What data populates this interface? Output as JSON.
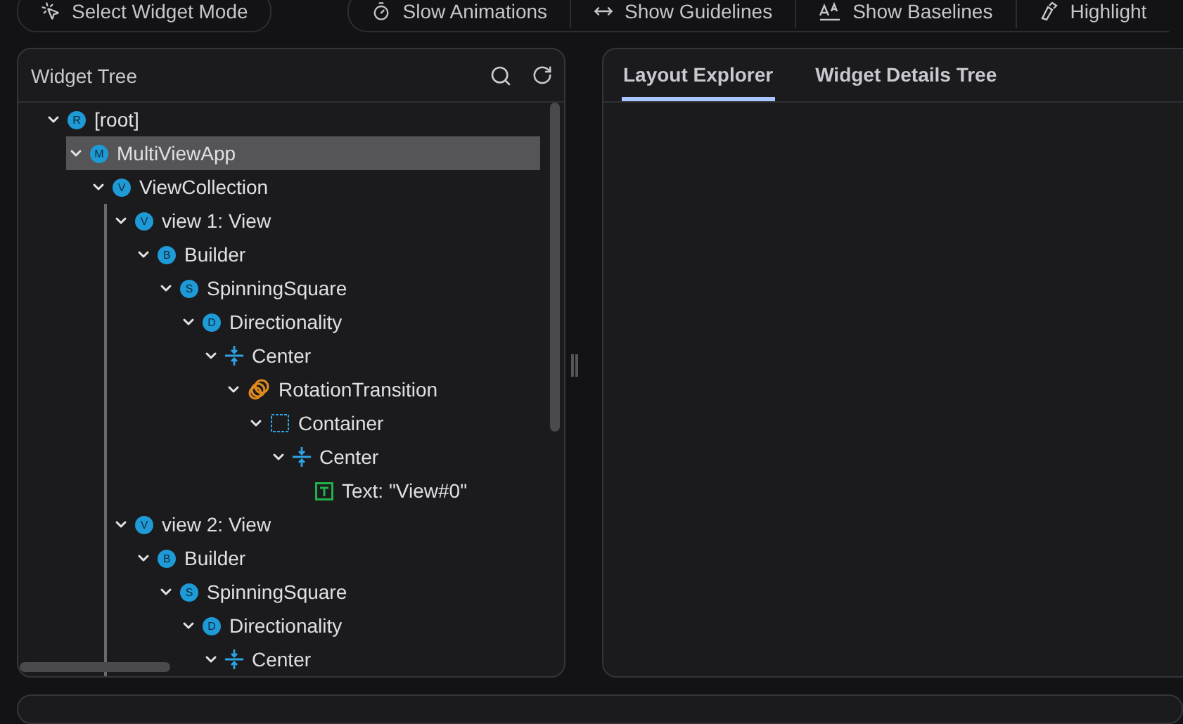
{
  "toolbar": {
    "buttons": [
      {
        "label": "Select Widget Mode",
        "kind": "pointer"
      },
      {
        "label": "Slow Animations",
        "kind": "timer"
      },
      {
        "label": "Show Guidelines",
        "kind": "guidelines"
      },
      {
        "label": "Show Baselines",
        "kind": "baselines"
      },
      {
        "label": "Highlight",
        "kind": "highlight"
      }
    ]
  },
  "widget_tree": {
    "title": "Widget Tree",
    "nodes": [
      {
        "label": "[root]",
        "kind": "badge",
        "badge": "R",
        "expanded": true,
        "selected": false,
        "children": [
          {
            "label": "MultiViewApp",
            "kind": "badge",
            "badge": "M",
            "expanded": true,
            "selected": true,
            "children": [
              {
                "label": "ViewCollection",
                "kind": "badge",
                "badge": "V",
                "expanded": true,
                "selected": false,
                "children": [
                  {
                    "label": "view 1: View",
                    "kind": "badge",
                    "badge": "V",
                    "expanded": true,
                    "selected": false,
                    "children": [
                      {
                        "label": "Builder",
                        "kind": "badge",
                        "badge": "B",
                        "expanded": true,
                        "selected": false,
                        "children": [
                          {
                            "label": "SpinningSquare",
                            "kind": "badge",
                            "badge": "S",
                            "expanded": true,
                            "selected": false,
                            "children": [
                              {
                                "label": "Directionality",
                                "kind": "badge",
                                "badge": "D",
                                "expanded": true,
                                "selected": false,
                                "children": [
                                  {
                                    "label": "Center",
                                    "kind": "center",
                                    "expanded": true,
                                    "selected": false,
                                    "children": [
                                      {
                                        "label": "RotationTransition",
                                        "kind": "rotation",
                                        "expanded": true,
                                        "selected": false,
                                        "children": [
                                          {
                                            "label": "Container",
                                            "kind": "container",
                                            "expanded": true,
                                            "selected": false,
                                            "children": [
                                              {
                                                "label": "Center",
                                                "kind": "center",
                                                "expanded": true,
                                                "selected": false,
                                                "children": [
                                                  {
                                                    "label": "Text: \"View#0\"",
                                                    "kind": "text",
                                                    "selected": false
                                                  }
                                                ]
                                              }
                                            ]
                                          }
                                        ]
                                      }
                                    ]
                                  }
                                ]
                              }
                            ]
                          }
                        ]
                      }
                    ]
                  },
                  {
                    "label": "view 2: View",
                    "kind": "badge",
                    "badge": "V",
                    "expanded": true,
                    "selected": false,
                    "children": [
                      {
                        "label": "Builder",
                        "kind": "badge",
                        "badge": "B",
                        "expanded": true,
                        "selected": false,
                        "children": [
                          {
                            "label": "SpinningSquare",
                            "kind": "badge",
                            "badge": "S",
                            "expanded": true,
                            "selected": false,
                            "children": [
                              {
                                "label": "Directionality",
                                "kind": "badge",
                                "badge": "D",
                                "expanded": true,
                                "selected": false,
                                "children": [
                                  {
                                    "label": "Center",
                                    "kind": "center",
                                    "expanded": true,
                                    "selected": false
                                  }
                                ]
                              }
                            ]
                          }
                        ]
                      }
                    ]
                  }
                ]
              }
            ]
          }
        ]
      }
    ]
  },
  "details": {
    "tabs": [
      {
        "label": "Layout Explorer",
        "selected": true
      },
      {
        "label": "Widget Details Tree",
        "selected": false
      }
    ]
  }
}
